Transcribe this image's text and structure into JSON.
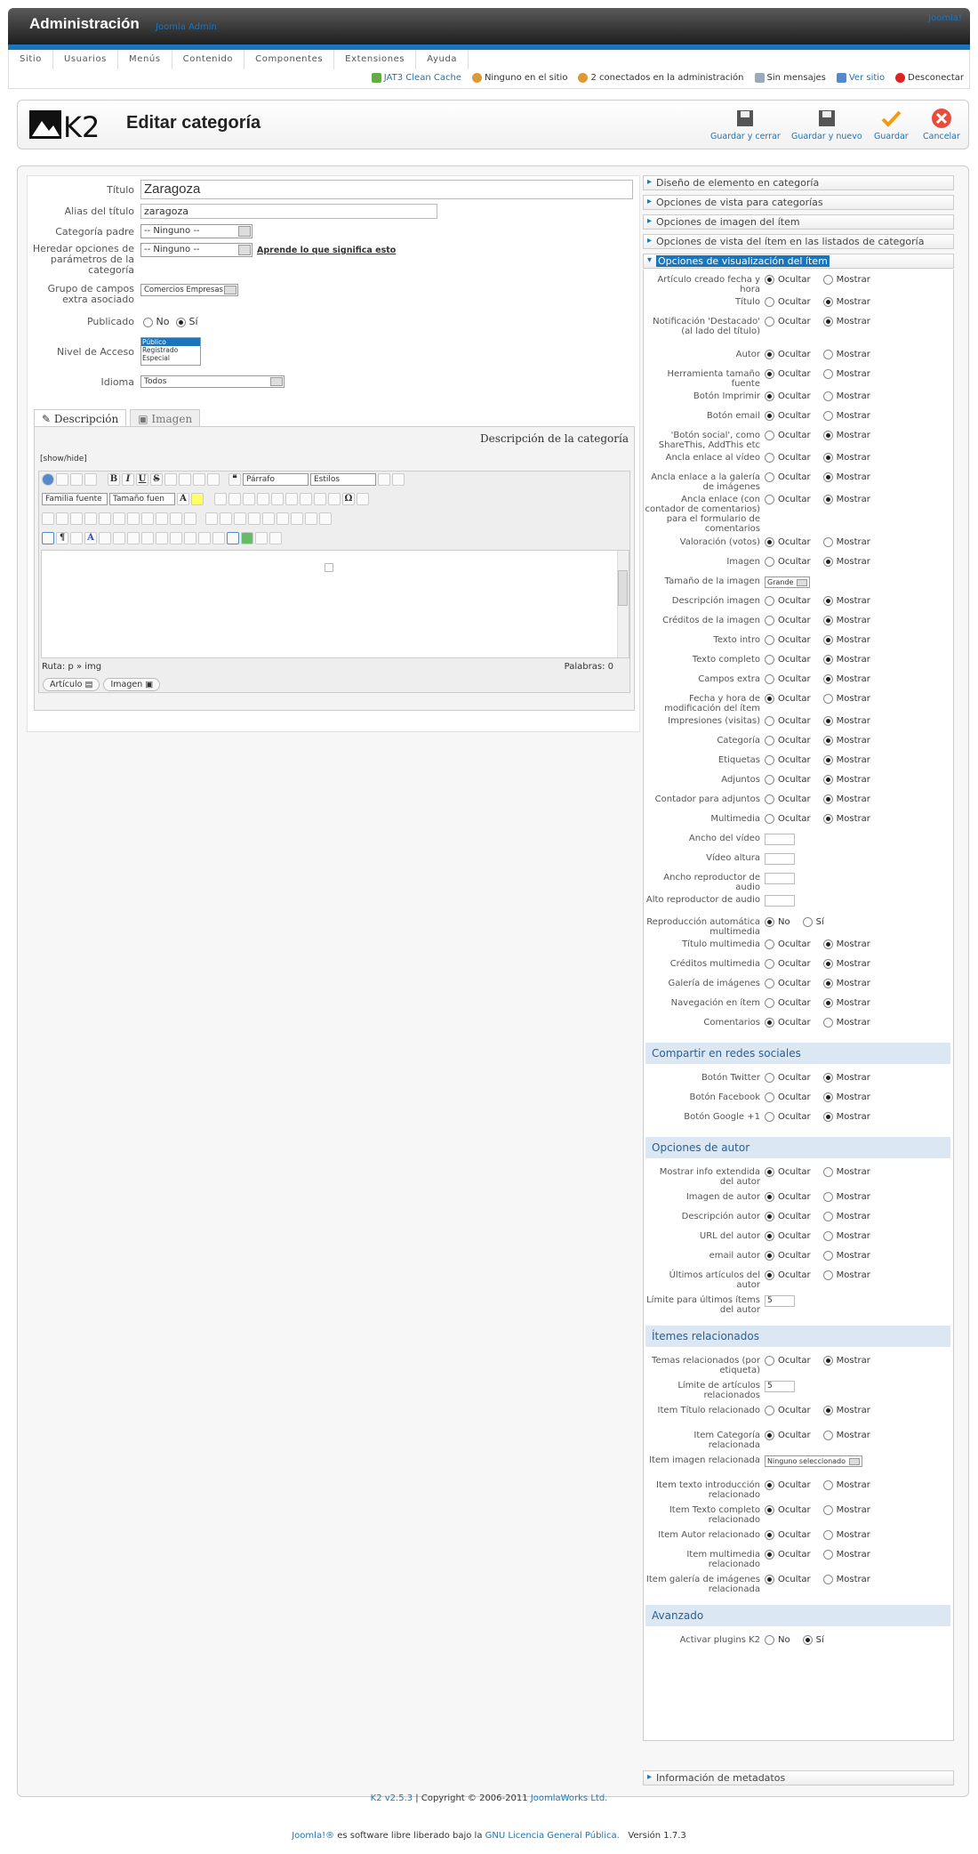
{
  "header": {
    "title": "Administración",
    "subtitle": "Joomla Admin",
    "joomla_link": "Joomla!"
  },
  "menu": [
    "Sitio",
    "Usuarios",
    "Menús",
    "Contenido",
    "Componentes",
    "Extensiones",
    "Ayuda"
  ],
  "status": [
    "JAT3 Clean Cache",
    "Ninguno en el sitio",
    "2 conectados en la administración",
    "Sin mensajes",
    "Ver sitio",
    "Desconectar"
  ],
  "toolbar": {
    "logo": "K2",
    "title": "Editar categoría",
    "buttons": [
      "Guardar y cerrar",
      "Guardar y nuevo",
      "Guardar",
      "Cancelar"
    ]
  },
  "form": {
    "title_label": "Título",
    "title_value": "Zaragoza",
    "alias_label": "Alias del título",
    "alias_value": "zaragoza",
    "parent_label": "Categoría padre",
    "parent_value": "-- Ninguno --",
    "inherit_label": "Heredar opciones de parámetros de la categoría",
    "inherit_value": "-- Ninguno --",
    "inherit_link": "Aprende lo que significa esto",
    "fields_label": "Grupo de campos extra asociado",
    "fields_value": "Comercios Empresas",
    "published_label": "Publicado",
    "no": "No",
    "yes": "Sí",
    "access_label": "Nivel de Acceso",
    "access_options": [
      "Público",
      "Registrado",
      "Especial"
    ],
    "lang_label": "Idioma",
    "lang_value": "Todos"
  },
  "editor": {
    "tab_desc": "Descripción",
    "tab_img": "Imagen",
    "heading": "Descripción de la categoría",
    "showhide": "[show/hide]",
    "format": "Párrafo",
    "styles": "Estilos",
    "font_family": "Familia fuente",
    "font_size": "Tamaño fuen",
    "path": "Ruta: p » img",
    "words": "Palabras: 0",
    "btn_article": "Artículo",
    "btn_image": "Imagen"
  },
  "panels": {
    "p1": "Diseño de elemento en categoría",
    "p2": "Opciones de vista para categorías",
    "p3": "Opciones de imagen del ítem",
    "p4": "Opciones de vista del ítem en las listados de categoría",
    "p5": "Opciones de visualización del ítem",
    "p_meta": "Información de metadatos"
  },
  "options": {
    "ocultar": "Ocultar",
    "mostrar": "Mostrar",
    "no": "No",
    "si": "Sí"
  },
  "display_options": [
    {
      "label": "Artículo creado fecha y hora",
      "sel": "o"
    },
    {
      "label": "Título",
      "sel": "m"
    },
    {
      "label": "Notificación 'Destacado' (al lado del título)",
      "sel": "m"
    },
    {
      "label": "Autor",
      "sel": "o"
    },
    {
      "label": "Herramienta tamaño fuente",
      "sel": "o"
    },
    {
      "label": "Botón Imprimir",
      "sel": "o"
    },
    {
      "label": "Botón email",
      "sel": "o"
    },
    {
      "label": "'Botón social', como ShareThis, AddThis etc",
      "sel": "m"
    },
    {
      "label": "Ancla enlace al vídeo",
      "sel": "m"
    },
    {
      "label": "Ancla enlace a la galería de imágenes",
      "sel": "m"
    },
    {
      "label": "Ancla enlace (con contador de comentarios) para el formulario de comentarios",
      "sel": "m"
    },
    {
      "label": "Valoración (votos)",
      "sel": "o"
    },
    {
      "label": "Imagen",
      "sel": "m"
    },
    {
      "label": "Tamaño de la imagen",
      "type": "select",
      "value": "Grande"
    },
    {
      "label": "Descripción imagen",
      "sel": "m"
    },
    {
      "label": "Créditos de la imagen",
      "sel": "m"
    },
    {
      "label": "Texto intro",
      "sel": "m"
    },
    {
      "label": "Texto completo",
      "sel": "m"
    },
    {
      "label": "Campos extra",
      "sel": "m"
    },
    {
      "label": "Fecha y hora de modificación del ítem",
      "sel": "o"
    },
    {
      "label": "Impresiones (visitas)",
      "sel": "m"
    },
    {
      "label": "Categoría",
      "sel": "m"
    },
    {
      "label": "Etiquetas",
      "sel": "m"
    },
    {
      "label": "Adjuntos",
      "sel": "m"
    },
    {
      "label": "Contador para adjuntos",
      "sel": "m"
    },
    {
      "label": "Multimedia",
      "sel": "m"
    },
    {
      "label": "Ancho del vídeo",
      "type": "text",
      "value": ""
    },
    {
      "label": "Vídeo altura",
      "type": "text",
      "value": ""
    },
    {
      "label": "Ancho reproductor de audio",
      "type": "text",
      "value": ""
    },
    {
      "label": "Alto reproductor de audio",
      "type": "text",
      "value": ""
    },
    {
      "label": "Reproducción automática multimedia",
      "type": "yn",
      "sel": "n"
    },
    {
      "label": "Título multimedia",
      "sel": "m"
    },
    {
      "label": "Créditos multimedia",
      "sel": "m"
    },
    {
      "label": "Galería de imágenes",
      "sel": "m"
    },
    {
      "label": "Navegación en ítem",
      "sel": "m"
    },
    {
      "label": "Comentarios",
      "sel": "o"
    }
  ],
  "social_title": "Compartir en redes sociales",
  "social_options": [
    {
      "label": "Botón Twitter",
      "sel": "m"
    },
    {
      "label": "Botón Facebook",
      "sel": "m"
    },
    {
      "label": "Botón Google +1",
      "sel": "m"
    }
  ],
  "author_title": "Opciones de autor",
  "author_options": [
    {
      "label": "Mostrar info extendida del autor",
      "sel": "o"
    },
    {
      "label": "Imagen de autor",
      "sel": "o"
    },
    {
      "label": "Descripción autor",
      "sel": "o"
    },
    {
      "label": "URL del autor",
      "sel": "o"
    },
    {
      "label": "email autor",
      "sel": "o"
    },
    {
      "label": "Últimos artículos del autor",
      "sel": "o"
    },
    {
      "label": "Límite para últimos ítems del autor",
      "type": "text",
      "value": "5"
    }
  ],
  "related_title": "Ítemes relacionados",
  "related_options": [
    {
      "label": "Temas relacionados (por etiqueta)",
      "sel": "m"
    },
    {
      "label": "Límite de artículos relacionados",
      "type": "text",
      "value": "5"
    },
    {
      "label": "Item Título relacionado",
      "sel": "m"
    },
    {
      "label": "Item Categoría relacionada",
      "sel": "o"
    },
    {
      "label": "Item imagen relacionada",
      "type": "select",
      "value": "Ninguno seleccionado"
    },
    {
      "label": "Item texto introducción relacionado",
      "sel": "o"
    },
    {
      "label": "Item Texto completo relacionado",
      "sel": "o"
    },
    {
      "label": "Item Autor relacionado",
      "sel": "o"
    },
    {
      "label": "Item multimedia relacionado",
      "sel": "o"
    },
    {
      "label": "Item galería de imágenes relacionada",
      "sel": "o"
    }
  ],
  "advanced_title": "Avanzado",
  "advanced_options": [
    {
      "label": "Activar plugins K2",
      "type": "yn",
      "sel": "s"
    }
  ],
  "footer": {
    "version": "K2 v2.5.3",
    "copyright": "Copyright © 2006-2011",
    "company": "JoomlaWorks Ltd.",
    "joomla": "Joomla!®",
    "license_text": "es software libre liberado bajo la",
    "license": "GNU Licencia General Pública.",
    "jversion": "Versión 1.7.3"
  },
  "colors": {
    "accent": "#1b75bb",
    "header_dark": "#1e1e1e",
    "section_bg": "#dbe7f3",
    "cancel": "#e74c3c",
    "save": "#f39c12"
  }
}
